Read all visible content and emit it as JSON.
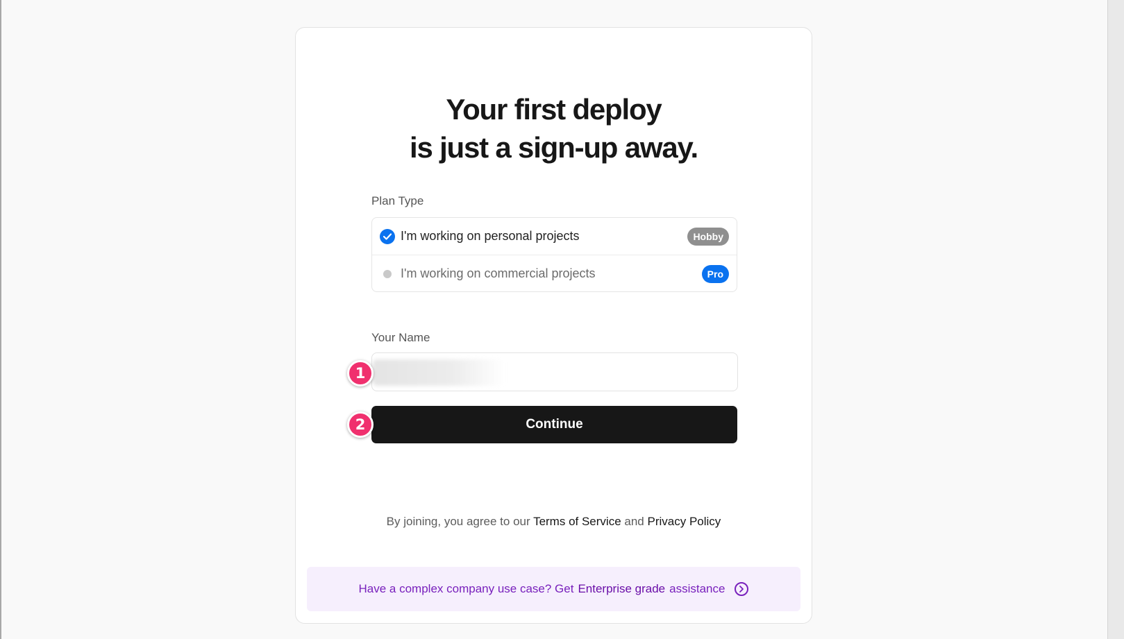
{
  "page": {
    "heading_line1": "Your first deploy",
    "heading_line2": "is just a sign-up away."
  },
  "plan": {
    "label": "Plan Type",
    "options": [
      {
        "text": "I'm working on personal projects",
        "badge": "Hobby",
        "selected": true
      },
      {
        "text": "I'm working on commercial projects",
        "badge": "Pro",
        "selected": false
      }
    ]
  },
  "name": {
    "label": "Your Name",
    "value": ""
  },
  "continue_label": "Continue",
  "legal": {
    "prefix": "By joining, you agree to our",
    "terms": "Terms of Service",
    "and": "and",
    "privacy": "Privacy Policy"
  },
  "enterprise": {
    "text_prefix": "Have a complex company use case? Get",
    "text_strong": "Enterprise grade",
    "text_suffix": "assistance"
  },
  "markers": {
    "first": "1",
    "second": "2"
  },
  "colors": {
    "accent": "#0a72ef",
    "button": "#171717",
    "enterprise_text": "#7820bc",
    "enterprise_bg": "#f6effd",
    "marker": "#f0306e"
  },
  "icons": {
    "selected_radio": "check-icon",
    "enterprise_arrow": "chevron-right-circle-icon"
  }
}
